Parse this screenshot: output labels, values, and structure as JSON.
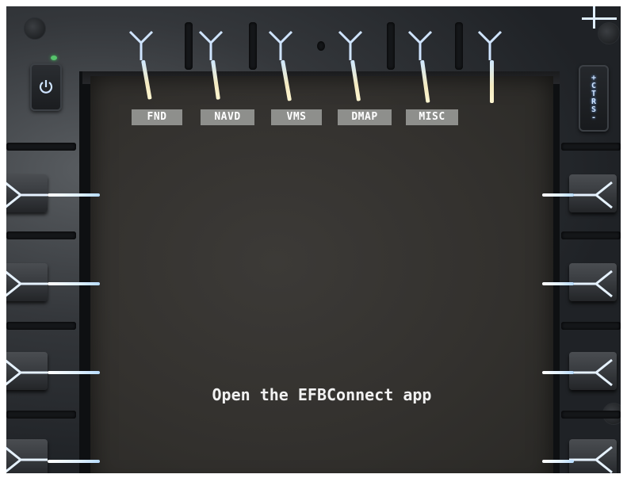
{
  "tabs": [
    {
      "label": "FND"
    },
    {
      "label": "NAVD"
    },
    {
      "label": "VMS"
    },
    {
      "label": "DMAP"
    },
    {
      "label": "MISC"
    }
  ],
  "ctrs_button": {
    "lines": [
      "+",
      "C",
      "T",
      "R",
      "S",
      "-"
    ]
  },
  "screen": {
    "message": "Open the EFBConnect app"
  },
  "icons": {
    "power": "power-icon",
    "softkey": "softkey-arrow-icon"
  },
  "colors": {
    "tab_bg": "#8e8f8c",
    "screen_bg": "#33312e",
    "accent_blue": "#cfe4ff",
    "led_green": "#56c46b"
  }
}
